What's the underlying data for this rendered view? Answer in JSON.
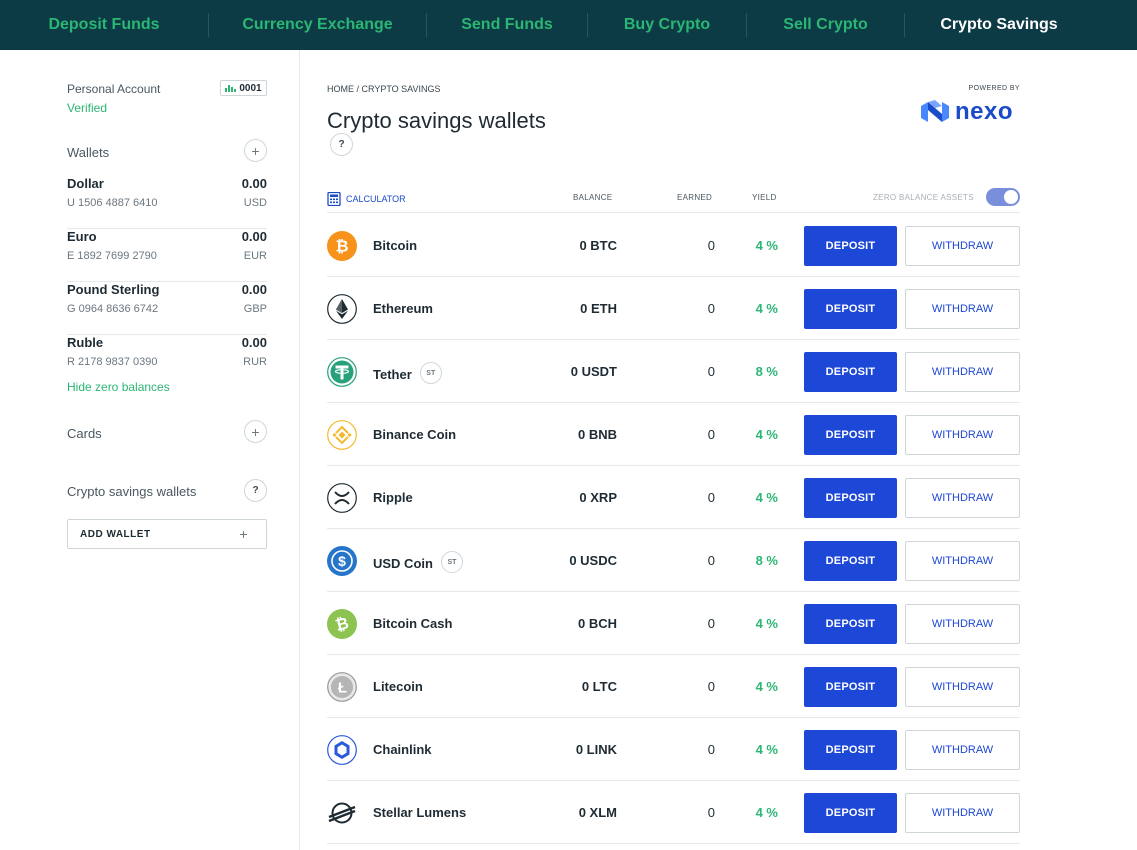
{
  "nav": {
    "items": [
      {
        "label": "Deposit Funds",
        "active": false
      },
      {
        "label": "Currency Exchange",
        "active": false
      },
      {
        "label": "Send Funds",
        "active": false
      },
      {
        "label": "Buy Crypto",
        "active": false
      },
      {
        "label": "Sell Crypto",
        "active": false
      },
      {
        "label": "Crypto Savings",
        "active": true
      }
    ]
  },
  "account": {
    "name": "Personal Account",
    "status": "Verified",
    "number": "0001"
  },
  "sidebar": {
    "wallets_title": "Wallets",
    "wallets": [
      {
        "name": "Dollar",
        "balance": "0.00",
        "account": "U 1506 4887 6410",
        "currency": "USD"
      },
      {
        "name": "Euro",
        "balance": "0.00",
        "account": "E 1892 7699 2790",
        "currency": "EUR"
      },
      {
        "name": "Pound Sterling",
        "balance": "0.00",
        "account": "G 0964 8636 6742",
        "currency": "GBP"
      },
      {
        "name": "Ruble",
        "balance": "0.00",
        "account": "R 2178 9837 0390",
        "currency": "RUR"
      }
    ],
    "hide_zero": "Hide zero balances",
    "cards_title": "Cards",
    "crypto_title": "Crypto savings wallets",
    "add_wallet": "ADD WALLET",
    "plus": "+",
    "question": "?"
  },
  "main": {
    "breadcrumb": "HOME / CRYPTO SAVINGS",
    "title": "Crypto savings wallets",
    "help": "?",
    "powered_by": "POWERED BY",
    "brand": "nexo",
    "header": {
      "calculator": "CALCULATOR",
      "balance": "BALANCE",
      "earned": "EARNED",
      "yield": "YIELD",
      "zero_assets": "ZERO BALANCE ASSETS"
    },
    "deposit_label": "DEPOSIT",
    "withdraw_label": "WITHDRAW",
    "coins": [
      {
        "name": "Bitcoin",
        "badge": "",
        "balance": "0 BTC",
        "earned": "0",
        "yield": "4 %",
        "icon": "bitcoin-icon",
        "color": "#f7931a"
      },
      {
        "name": "Ethereum",
        "badge": "",
        "balance": "0 ETH",
        "earned": "0",
        "yield": "4 %",
        "icon": "ethereum-icon",
        "color": "#1f2b33"
      },
      {
        "name": "Tether",
        "badge": "ST",
        "balance": "0 USDT",
        "earned": "0",
        "yield": "8 %",
        "icon": "tether-icon",
        "color": "#26a17b"
      },
      {
        "name": "Binance Coin",
        "badge": "",
        "balance": "0 BNB",
        "earned": "0",
        "yield": "4 %",
        "icon": "binance-coin-icon",
        "color": "#f3ba2f"
      },
      {
        "name": "Ripple",
        "badge": "",
        "balance": "0 XRP",
        "earned": "0",
        "yield": "4 %",
        "icon": "ripple-icon",
        "color": "#1f2b33"
      },
      {
        "name": "USD Coin",
        "badge": "ST",
        "balance": "0 USDC",
        "earned": "0",
        "yield": "8 %",
        "icon": "usd-coin-icon",
        "color": "#2775ca"
      },
      {
        "name": "Bitcoin Cash",
        "badge": "",
        "balance": "0 BCH",
        "earned": "0",
        "yield": "4 %",
        "icon": "bitcoin-cash-icon",
        "color": "#8dc351"
      },
      {
        "name": "Litecoin",
        "badge": "",
        "balance": "0 LTC",
        "earned": "0",
        "yield": "4 %",
        "icon": "litecoin-icon",
        "color": "#9a9a9a"
      },
      {
        "name": "Chainlink",
        "badge": "",
        "balance": "0 LINK",
        "earned": "0",
        "yield": "4 %",
        "icon": "chainlink-icon",
        "color": "#2a5ada"
      },
      {
        "name": "Stellar Lumens",
        "badge": "",
        "balance": "0 XLM",
        "earned": "0",
        "yield": "4 %",
        "icon": "stellar-lumens-icon",
        "color": "#1f2b33"
      }
    ]
  }
}
